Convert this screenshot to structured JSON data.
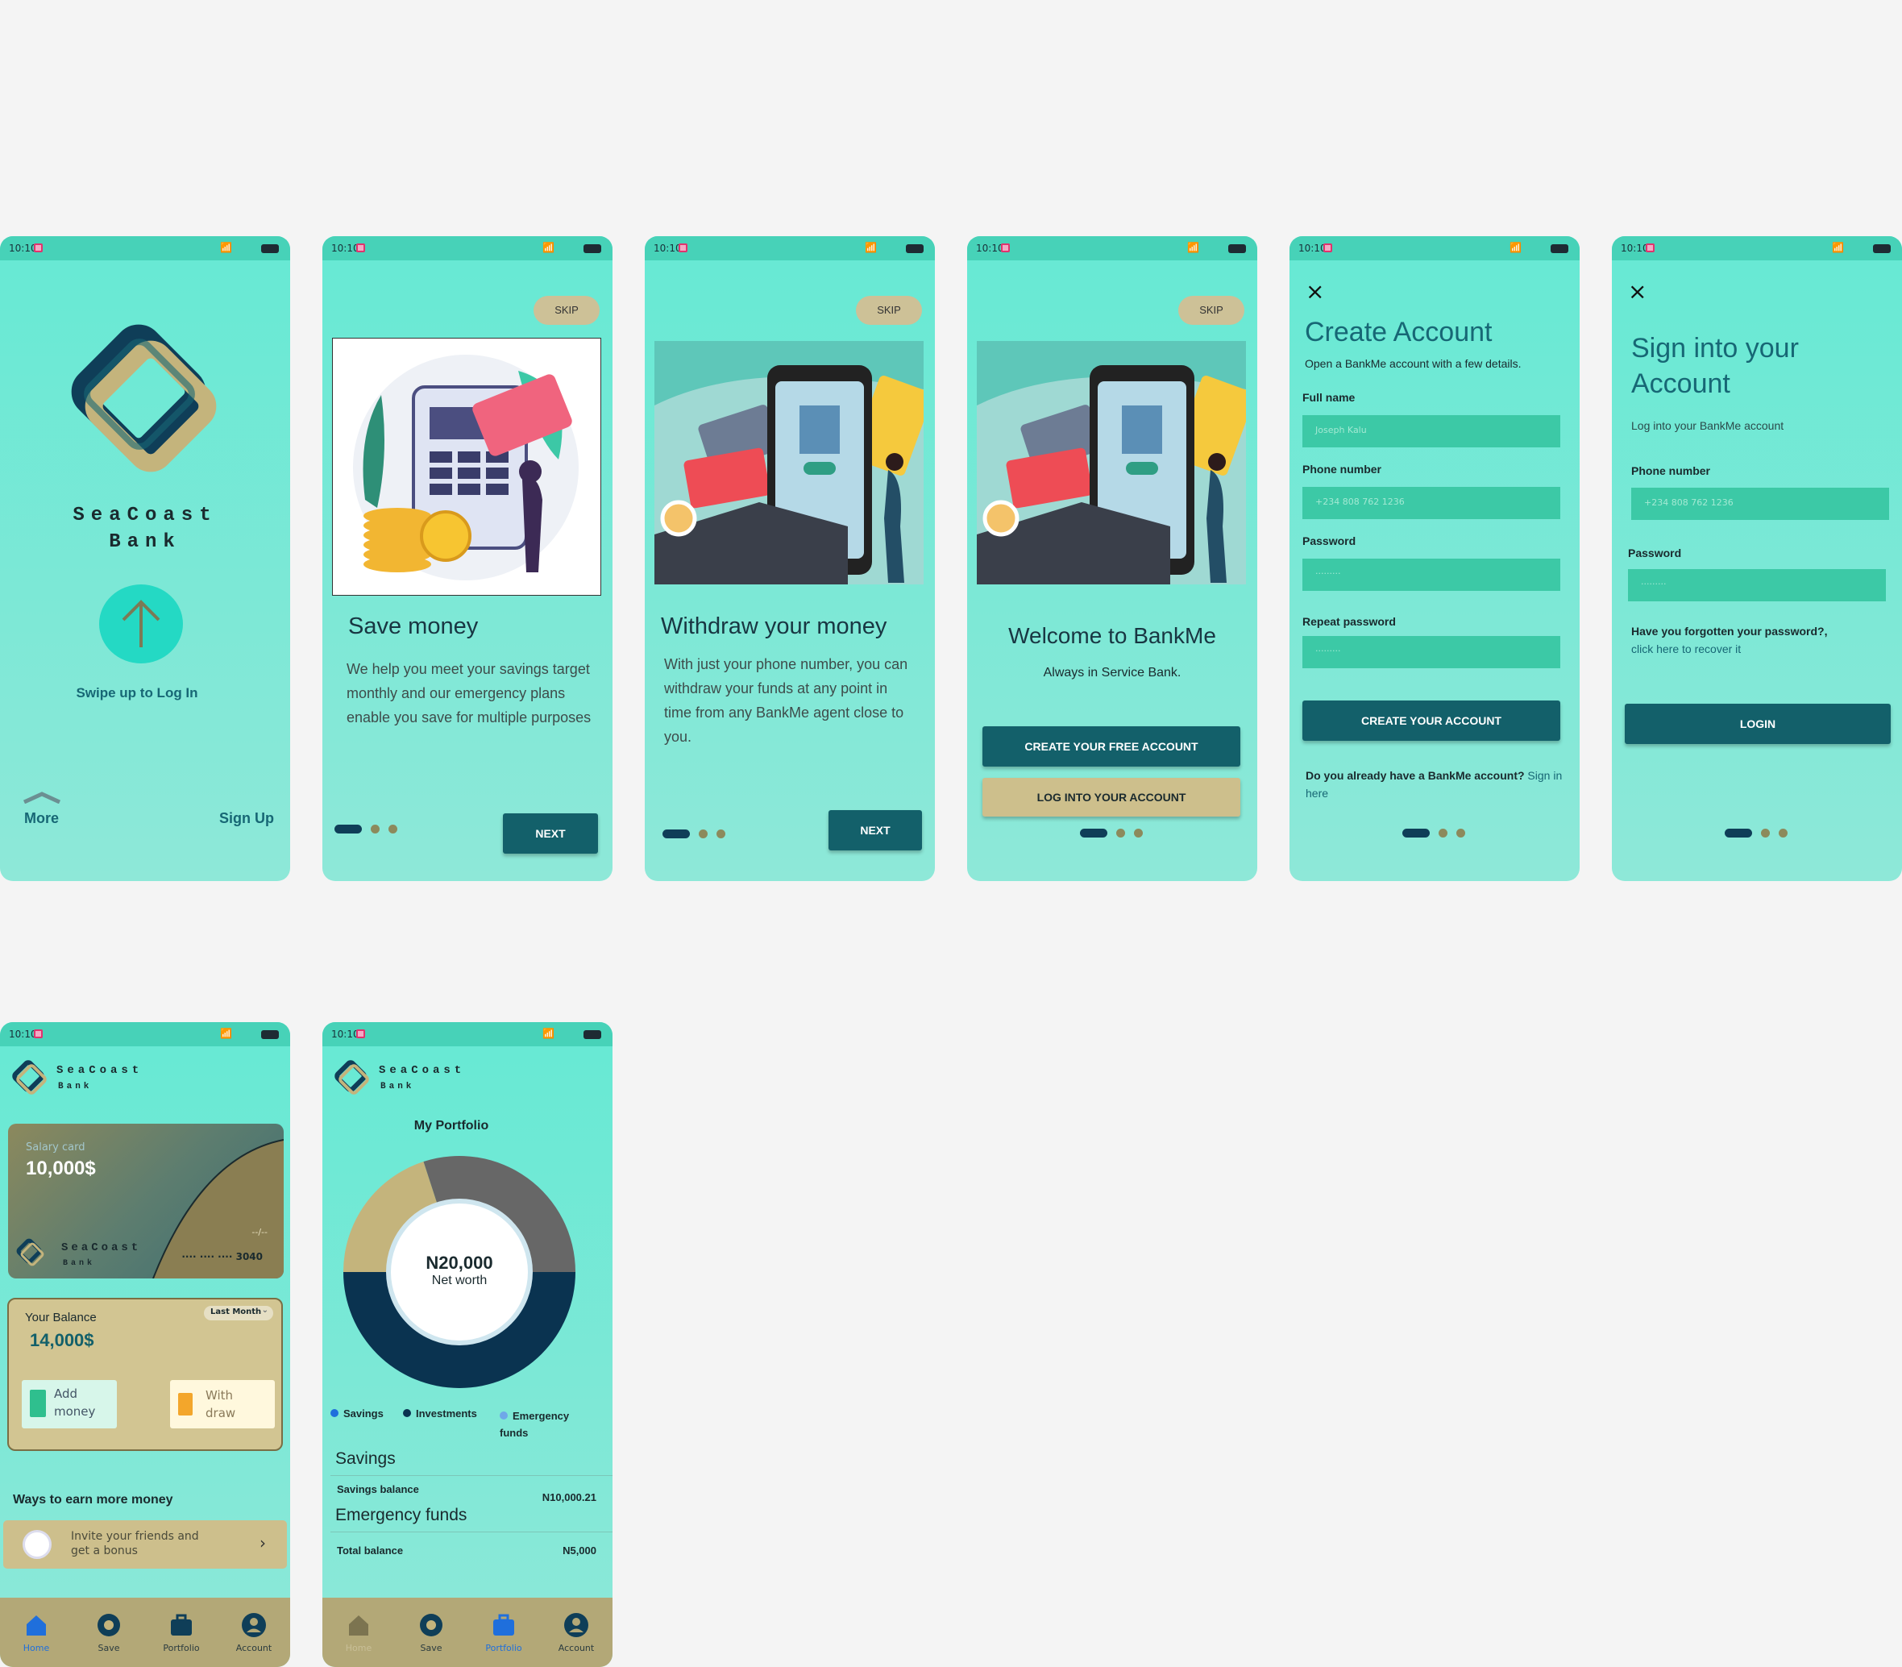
{
  "status_bar": {
    "time": "10:10"
  },
  "splash": {
    "brand_line1": "SeaCoast",
    "brand_line2": "Bank",
    "swipe_label": "Swipe up to Log In",
    "more_label": "More",
    "signup_label": "Sign Up"
  },
  "onboard1": {
    "skip": "SKIP",
    "title": "Save money",
    "body": "We help you meet your savings target monthly and our emergency plans enable you save for multiple purposes",
    "next": "NEXT"
  },
  "onboard2": {
    "skip": "SKIP",
    "title": "Withdraw your money",
    "body": "With just your phone number, you can withdraw your funds at any point in time from any BankMe agent close to you.",
    "next": "NEXT"
  },
  "welcome": {
    "skip": "SKIP",
    "title": "Welcome to BankMe",
    "subtitle": "Always in Service Bank.",
    "create_btn": "CREATE YOUR FREE ACCOUNT",
    "login_btn": "LOG INTO YOUR ACCOUNT"
  },
  "create": {
    "close": "×",
    "title": "Create Account",
    "subtitle": "Open a BankMe account with a few details.",
    "fullname_label": "Full name",
    "fullname_placeholder": "Joseph Kalu",
    "phone_label": "Phone number",
    "phone_placeholder": "+234 808 762 1236",
    "password_label": "Password",
    "password_placeholder": "·········",
    "repeat_label": "Repeat password",
    "repeat_placeholder": "·········",
    "submit": "CREATE YOUR ACCOUNT",
    "have_account": "Do you already have a BankMe account?",
    "signin_link": "Sign in here"
  },
  "signin": {
    "close": "×",
    "title_line1": "Sign into your",
    "title_line2": "Account",
    "subtitle": "Log into your BankMe account",
    "phone_label": "Phone number",
    "phone_placeholder": "+234 808 762 1236",
    "password_label": "Password",
    "password_placeholder": "·········",
    "forgot": "Have you forgotten your password?,",
    "recover": "click here to recover it",
    "submit": "LOGIN"
  },
  "home": {
    "brand_line1": "SeaCoast",
    "brand_line2": "Bank",
    "card_label": "Salary card",
    "card_amount": "10,000$",
    "card_brand": "SeaCoast",
    "card_brand2": "Bank",
    "card_expiry": "--/--",
    "card_number": "···· ···· ···· 3040",
    "balance_label": "Your Balance",
    "period": "Last Month",
    "balance": "14,000$",
    "add_line1": "Add",
    "add_line2": "money",
    "withdraw_line1": "With",
    "withdraw_line2": "draw",
    "earn_title": "Ways to earn more money",
    "invite_line1": "Invite your friends and",
    "invite_line2": "get a bonus",
    "nav": [
      "Home",
      "Save",
      "Portfolio",
      "Account"
    ]
  },
  "portfolio": {
    "brand_line1": "SeaCoast",
    "brand_line2": "Bank",
    "title": "My Portfolio",
    "net_amount": "N20,000",
    "net_label": "Net worth",
    "legend": [
      "Savings",
      "Investments",
      "Emergency funds"
    ],
    "savings_title": "Savings",
    "savings_balance_label": "Savings balance",
    "savings_balance": "N10,000.21",
    "emergency_title": "Emergency funds",
    "total_label": "Total balance",
    "total_value": "N5,000",
    "nav": [
      "Home",
      "Save",
      "Portfolio",
      "Account"
    ]
  },
  "chart_data": {
    "type": "pie",
    "categories": [
      "Investments",
      "Emergency funds",
      "Savings"
    ],
    "values": [
      50,
      20,
      30
    ],
    "colors": [
      "#0a3350",
      "#c4b47c",
      "#676767"
    ]
  },
  "colors": {
    "teal": "#66e9d4",
    "dark": "#13606a",
    "navy": "#0f3e58",
    "khaki": "#c4b47c"
  }
}
